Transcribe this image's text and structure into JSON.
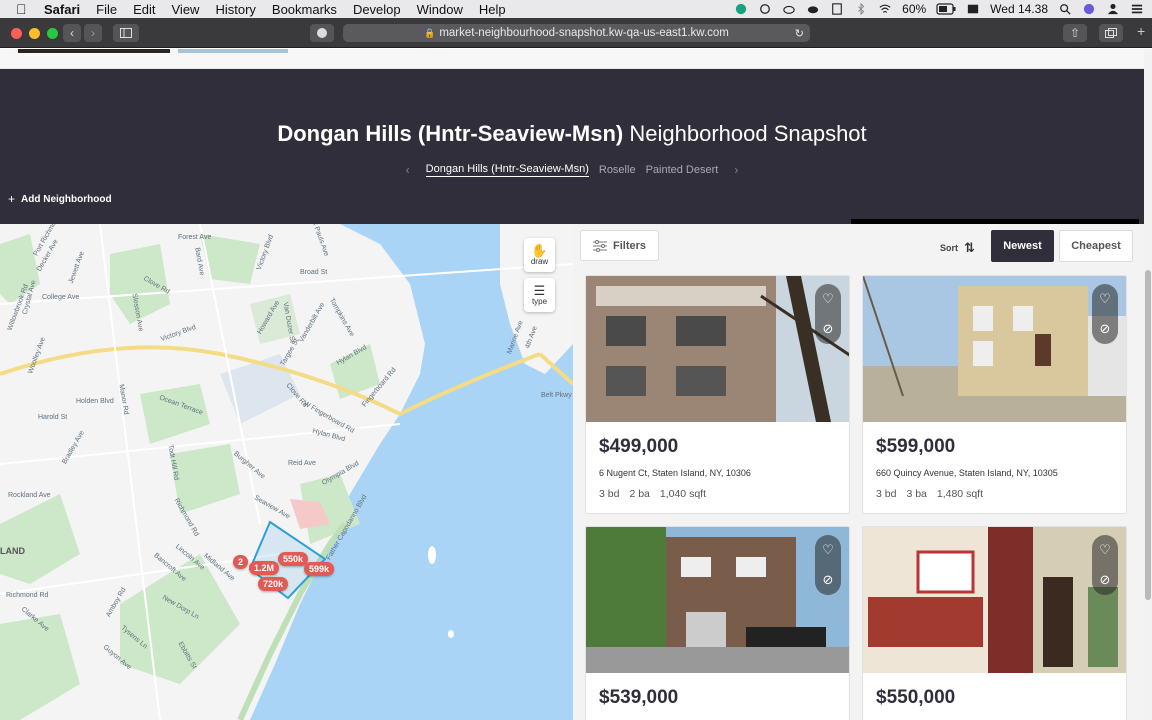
{
  "menubar": {
    "app": "Safari",
    "items": [
      "File",
      "Edit",
      "View",
      "History",
      "Bookmarks",
      "Develop",
      "Window",
      "Help"
    ],
    "battery": "60%",
    "clock": "Wed 14.38"
  },
  "browser": {
    "url": "market-neighbourhood-snapshot.kw-qa-us-east1.kw.com"
  },
  "hero": {
    "title_bold": "Dongan Hills (Hntr-Seaview-Msn)",
    "title_rest": " Neighborhood Snapshot",
    "neighborhoods": [
      "Dongan Hills (Hntr-Seaview-Msn)",
      "Roselle",
      "Painted Desert"
    ],
    "add_label": "Add Neighborhood"
  },
  "map": {
    "controls": {
      "draw": "draw",
      "type": "type"
    },
    "streets": [
      "Forest Ave",
      "Port Richmond",
      "Decker Ave",
      "Jewett Ave",
      "Bard Ave",
      "Victory Blvd",
      "Broad St",
      "St Pauls Ave",
      "Clove Rd",
      "College Ave",
      "Slosson Ave",
      "Crystal Ave",
      "Willowbrook Rd",
      "Howard Ave",
      "Van Duzer St",
      "Vanderbilt Ave",
      "Tompkins Ave",
      "Victory Blvd",
      "Targee St",
      "Hylan Blvd",
      "Woolley Ave",
      "Holden Blvd",
      "Manor Rd",
      "Ocean Terrace",
      "Clove Rd",
      "W Fingerboard Rd",
      "Fingerboard Rd",
      "Harold St",
      "Rockland Ave",
      "Hylan Blvd",
      "Bradley Ave",
      "Todt Hill Rd",
      "Burgher Ave",
      "Reid Ave",
      "Olympia Blvd",
      "Seaview Ave",
      "Richmond Rd",
      "Lincoln Ave",
      "Midland Ave",
      "Bancroft Ave",
      "Father Capodanno Blvd",
      "Richmond Rd",
      "Amboy Rd",
      "New Dorp Ln",
      "Clarke Ave",
      "Tysens Ln",
      "Ebbitts St",
      "Guyon Ave",
      "Belt Pkwy",
      "Marine Ave",
      "4th Ave",
      "LAND"
    ],
    "pins": [
      "2",
      "1.2M",
      "550k",
      "720k",
      "599k"
    ]
  },
  "listings": {
    "filters_label": "Filters",
    "sort_label": "Sort",
    "sort_options": [
      "Newest",
      "Cheapest"
    ],
    "cards": [
      {
        "price": "$499,000",
        "address": "6 Nugent Ct, Staten Island, NY, 10306",
        "beds": "3 bd",
        "baths": "2 ba",
        "sqft": "1,040 sqft"
      },
      {
        "price": "$599,000",
        "address": "660 Quincy Avenue, Staten Island, NY, 10305",
        "beds": "3 bd",
        "baths": "3 ba",
        "sqft": "1,480 sqft"
      },
      {
        "price": "$539,000",
        "address": "",
        "beds": "",
        "baths": "",
        "sqft": ""
      },
      {
        "price": "$550,000",
        "address": "",
        "beds": "",
        "baths": "",
        "sqft": ""
      }
    ]
  }
}
